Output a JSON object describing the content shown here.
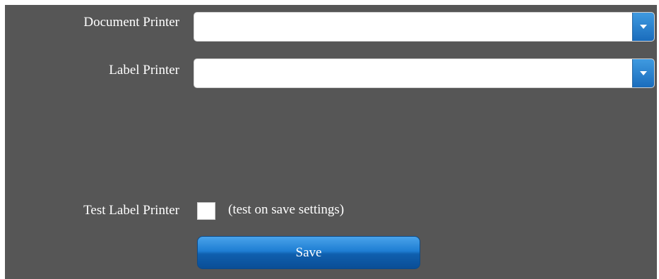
{
  "form": {
    "document_printer": {
      "label": "Document Printer",
      "value": ""
    },
    "label_printer": {
      "label": "Label Printer",
      "value": ""
    },
    "test_label_printer": {
      "label": "Test Label Printer",
      "checked": false,
      "hint": "(test on save settings)"
    },
    "save_label": "Save"
  },
  "colors": {
    "panel_background": "#565656",
    "accent": "#1e7ed3",
    "text": "#ffffff"
  },
  "icons": {
    "dropdown": "chevron-down-icon"
  }
}
